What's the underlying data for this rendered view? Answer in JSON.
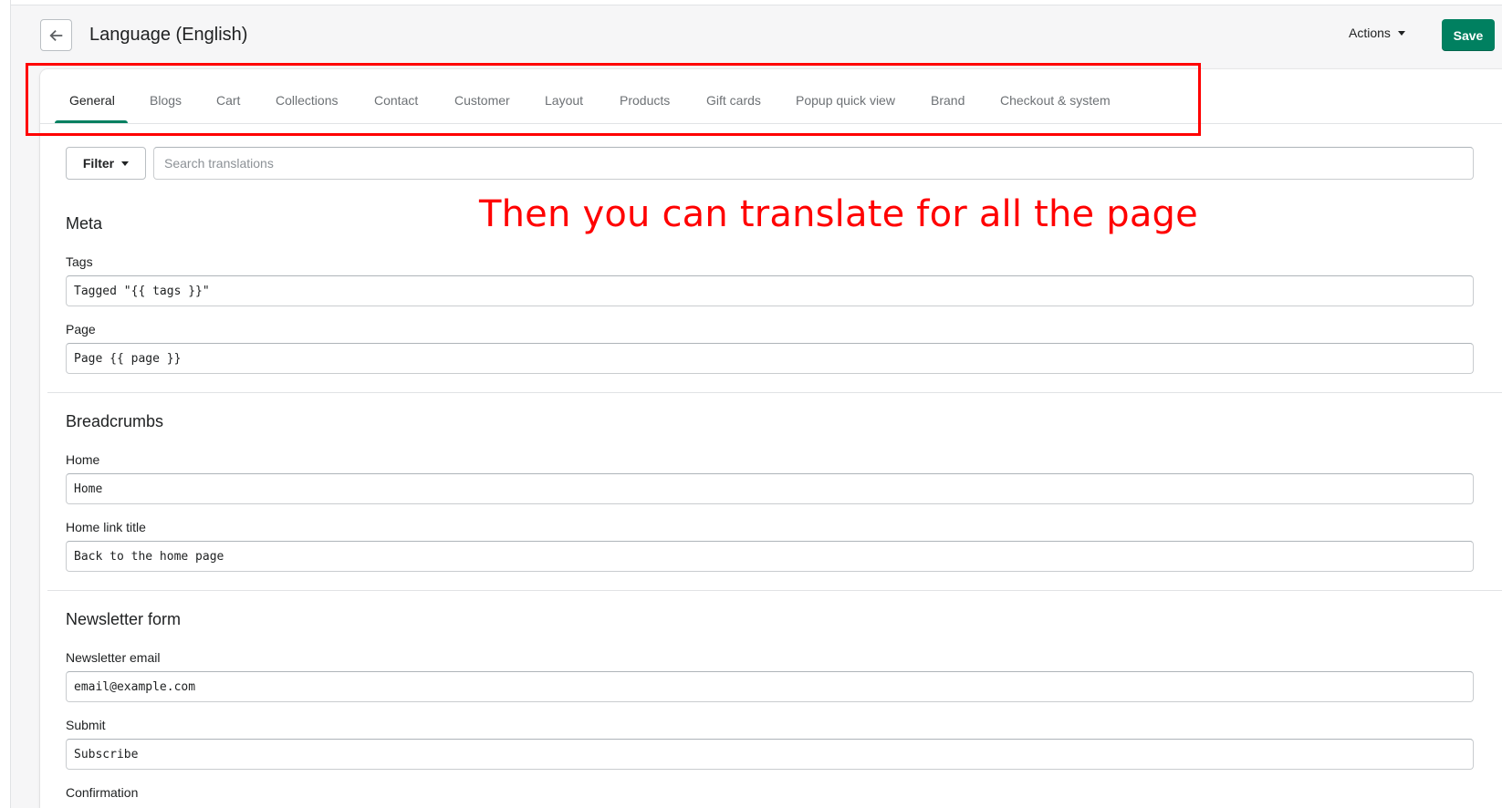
{
  "header": {
    "title": "Language (English)",
    "actions_label": "Actions",
    "save_label": "Save"
  },
  "tabs": [
    {
      "label": "General",
      "active": true
    },
    {
      "label": "Blogs"
    },
    {
      "label": "Cart"
    },
    {
      "label": "Collections"
    },
    {
      "label": "Contact"
    },
    {
      "label": "Customer"
    },
    {
      "label": "Layout"
    },
    {
      "label": "Products"
    },
    {
      "label": "Gift cards"
    },
    {
      "label": "Popup quick view"
    },
    {
      "label": "Brand"
    },
    {
      "label": "Checkout & system"
    }
  ],
  "filter": {
    "label": "Filter",
    "search_placeholder": "Search translations"
  },
  "annotation": {
    "text": "Then you can translate for all the page",
    "color": "#ff0000"
  },
  "sections": {
    "meta": {
      "title": "Meta",
      "tags_label": "Tags",
      "tags_value": "Tagged \"{{ tags }}\"",
      "page_label": "Page",
      "page_value": "Page {{ page }}"
    },
    "breadcrumbs": {
      "title": "Breadcrumbs",
      "home_label": "Home",
      "home_value": "Home",
      "home_link_label": "Home link title",
      "home_link_value": "Back to the home page"
    },
    "newsletter": {
      "title": "Newsletter form",
      "email_label": "Newsletter email",
      "email_value": "email@example.com",
      "submit_label": "Submit",
      "submit_value": "Subscribe",
      "confirmation_label": "Confirmation"
    }
  },
  "colors": {
    "primary": "#008060",
    "annotation": "#ff0000"
  }
}
